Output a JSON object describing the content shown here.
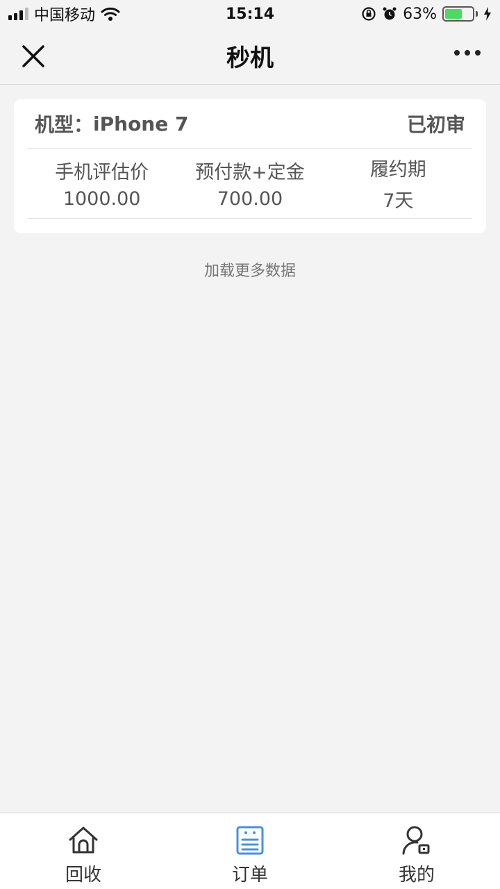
{
  "status_bar": {
    "carrier": "中国移动",
    "time": "15:14",
    "battery_pct": "63%",
    "battery_level": 0.63,
    "battery_color": "#4cd964",
    "icons": [
      "signal-icon",
      "wifi-icon",
      "orientation-lock-icon",
      "alarm-icon",
      "battery-icon",
      "charging-icon"
    ]
  },
  "nav": {
    "title": "秒机",
    "close_icon": "close-icon",
    "more_icon": "more-icon"
  },
  "order_card": {
    "model_label": "机型：",
    "model_value": "iPhone 7",
    "status": "已初审",
    "columns": [
      {
        "label": "手机评估价",
        "value": "1000.00"
      },
      {
        "label": "预付款+定金",
        "value": "700.00"
      },
      {
        "label": "履约期",
        "value": "7天"
      }
    ]
  },
  "load_more": "加载更多数据",
  "tab_bar": {
    "active_color": "#4a90d9",
    "tabs": [
      {
        "label": "回收",
        "icon": "home-icon",
        "active": false
      },
      {
        "label": "订单",
        "icon": "order-list-icon",
        "active": true
      },
      {
        "label": "我的",
        "icon": "profile-icon",
        "active": false
      }
    ]
  }
}
